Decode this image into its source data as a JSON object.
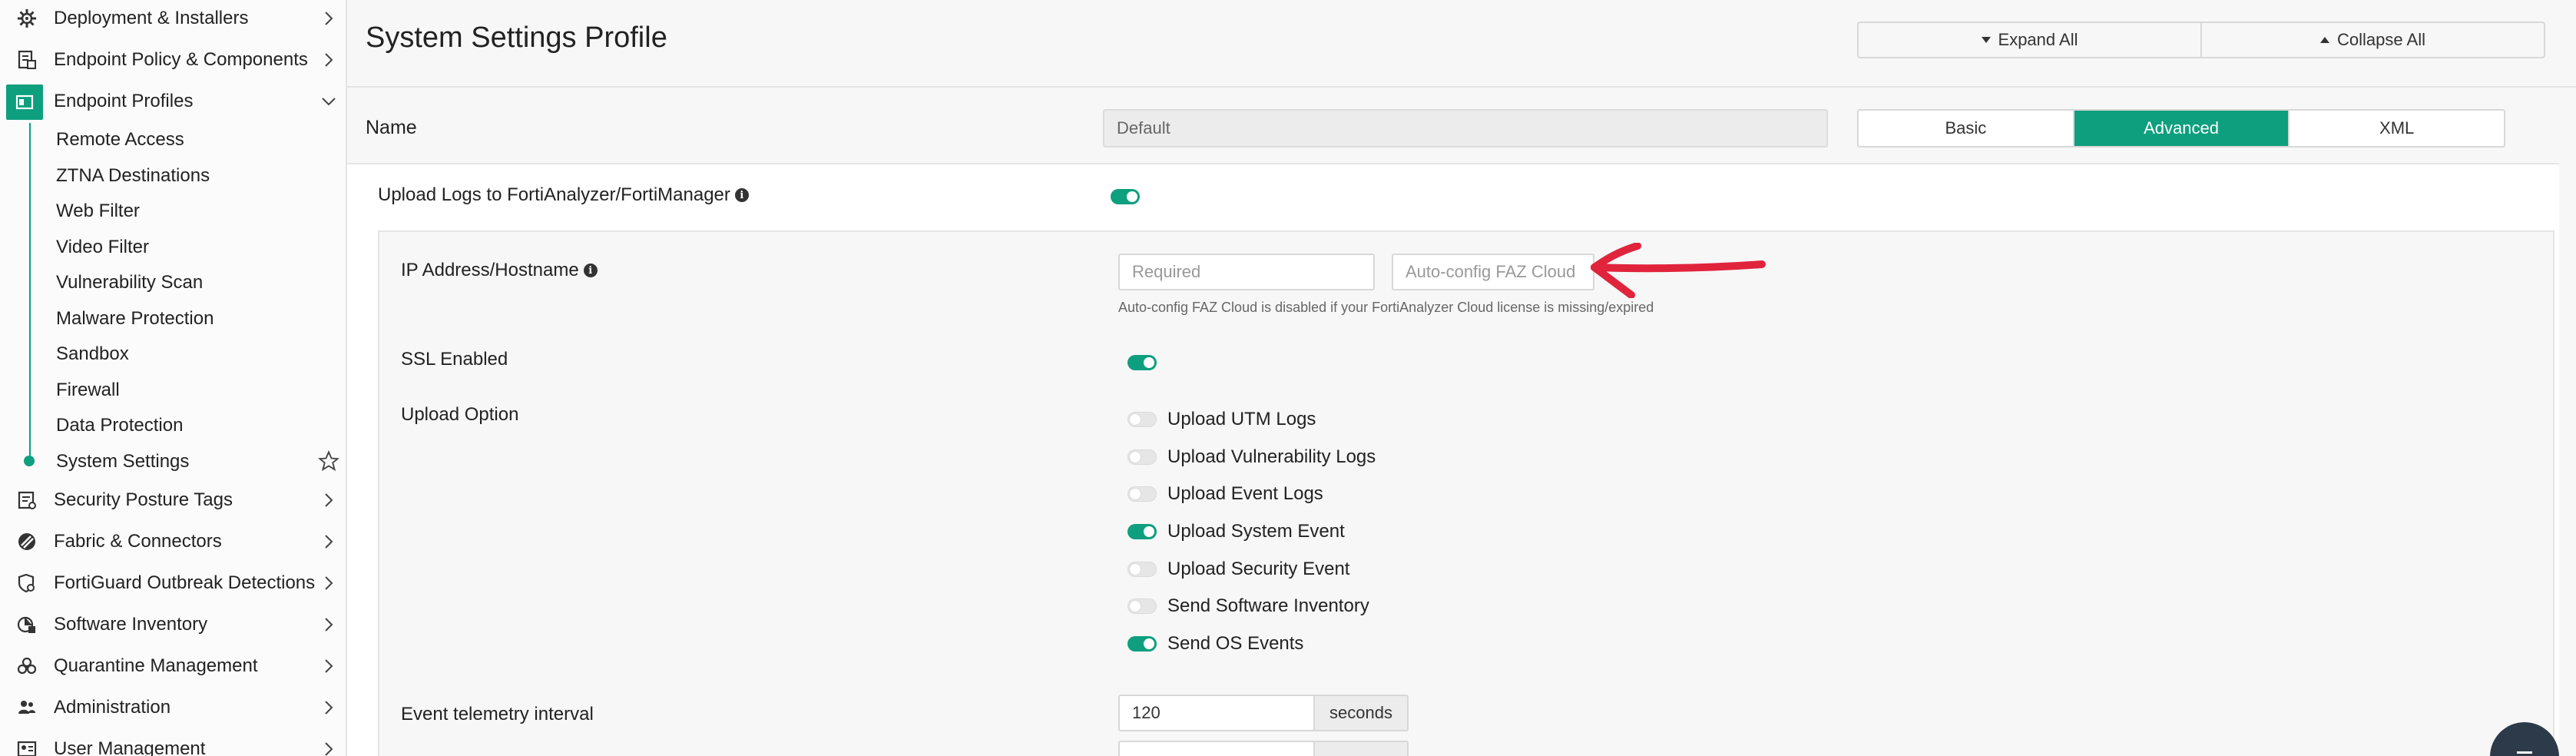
{
  "sidebar": {
    "items_top": [
      {
        "label": "Deployment & Installers",
        "icon": "installer-gear-icon"
      },
      {
        "label": "Endpoint Policy & Components",
        "icon": "policy-document-icon"
      },
      {
        "label": "Endpoint Profiles",
        "icon": "endpoint-profile-icon"
      }
    ],
    "sub_items": [
      {
        "label": "Remote Access"
      },
      {
        "label": "ZTNA Destinations"
      },
      {
        "label": "Web Filter"
      },
      {
        "label": "Video Filter"
      },
      {
        "label": "Vulnerability Scan"
      },
      {
        "label": "Malware Protection"
      },
      {
        "label": "Sandbox"
      },
      {
        "label": "Firewall"
      },
      {
        "label": "Data Protection"
      },
      {
        "label": "System Settings"
      }
    ],
    "items_bottom": [
      {
        "label": "Security Posture Tags",
        "icon": "tag-list-icon"
      },
      {
        "label": "Fabric & Connectors",
        "icon": "fabric-icon"
      },
      {
        "label": "FortiGuard Outbreak Detections",
        "icon": "outbreak-shield-icon"
      },
      {
        "label": "Software Inventory",
        "icon": "software-inventory-icon"
      },
      {
        "label": "Quarantine Management",
        "icon": "quarantine-biohazard-icon"
      },
      {
        "label": "Administration",
        "icon": "admin-users-icon"
      },
      {
        "label": "User Management",
        "icon": "user-card-icon"
      }
    ]
  },
  "header": {
    "title": "System Settings Profile",
    "expand_all": "Expand All",
    "collapse_all": "Collapse All"
  },
  "profile": {
    "name_label": "Name",
    "name_value": "Default",
    "modes": [
      "Basic",
      "Advanced",
      "XML"
    ],
    "active_mode": "Advanced"
  },
  "upload": {
    "label": "Upload Logs to FortiAnalyzer/FortiManager",
    "enabled": true,
    "ip_label": "IP Address/Hostname",
    "ip_placeholder": "Required",
    "auto_config_button": "Auto-config FAZ Cloud",
    "auto_config_hint": "Auto-config FAZ Cloud is disabled if your FortiAnalyzer Cloud license is missing/expired",
    "ssl_label": "SSL Enabled",
    "ssl_enabled": true,
    "upload_option_label": "Upload Option",
    "options": [
      {
        "label": "Upload UTM Logs",
        "enabled": false
      },
      {
        "label": "Upload Vulnerability Logs",
        "enabled": false
      },
      {
        "label": "Upload Event Logs",
        "enabled": false
      },
      {
        "label": "Upload System Event",
        "enabled": true
      },
      {
        "label": "Upload Security Event",
        "enabled": false
      },
      {
        "label": "Send Software Inventory",
        "enabled": false
      },
      {
        "label": "Send OS Events",
        "enabled": true
      }
    ],
    "telemetry_label": "Event telemetry interval",
    "telemetry_value": "120",
    "telemetry_unit": "seconds"
  },
  "colors": {
    "accent": "#0e9f7e",
    "annotation": "#e0243c"
  }
}
